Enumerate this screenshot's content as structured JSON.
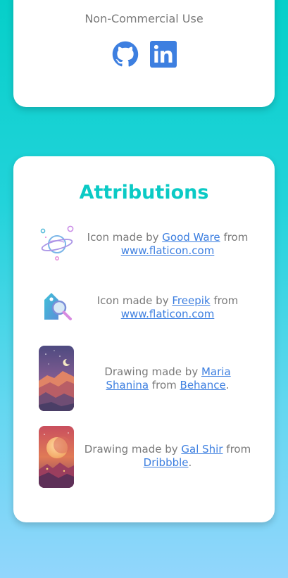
{
  "license": {
    "text": "Non-Commercial Use",
    "github_icon": "github-icon",
    "linkedin_icon": "linkedin-icon"
  },
  "attributions": {
    "title": "Attributions",
    "items": [
      {
        "prefix": "Icon made by ",
        "author": "Good Ware",
        "middle": " from ",
        "source": "www.flaticon.com",
        "suffix": "",
        "image": "planet-icon"
      },
      {
        "prefix": "Icon made by ",
        "author": "Freepik",
        "middle": " from ",
        "source": "www.flaticon.com",
        "suffix": "",
        "image": "tag-search-icon"
      },
      {
        "prefix": "Drawing made by ",
        "author": "Maria Shanina",
        "middle": " from ",
        "source": "Behance",
        "suffix": ".",
        "image": "desert-night-drawing"
      },
      {
        "prefix": "Drawing made by ",
        "author": "Gal Shir",
        "middle": " from ",
        "source": "Dribbble",
        "suffix": ".",
        "image": "moon-sunset-drawing"
      }
    ]
  },
  "colors": {
    "accent": "#0bcac5",
    "link": "#3d7fe0",
    "icon_blue": "#3d7fe0",
    "text_gray": "#7a7a7a"
  }
}
